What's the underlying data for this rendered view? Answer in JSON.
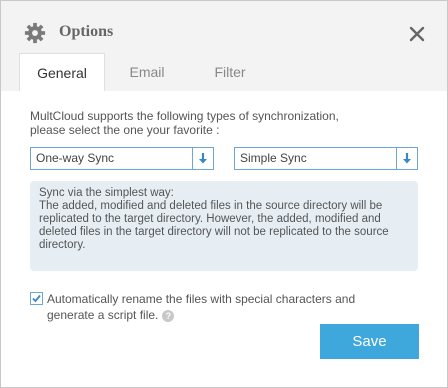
{
  "dialog": {
    "title": "Options",
    "icons": {
      "header": "gear-icon",
      "close": "close-icon",
      "select_arrow": "down-arrow-icon",
      "check": "checkmark-icon",
      "help": "question-icon"
    }
  },
  "tabs": [
    {
      "label": "General",
      "active": true
    },
    {
      "label": "Email",
      "active": false
    },
    {
      "label": "Filter",
      "active": false
    }
  ],
  "general": {
    "intro_line1": "MultCloud supports the following types of synchronization,",
    "intro_line2": "please select the one your favorite :",
    "sync_direction": {
      "value": "One-way Sync"
    },
    "sync_mode": {
      "value": "Simple Sync"
    },
    "info": {
      "heading": "Sync via the simplest way:",
      "body": "The added, modified and deleted files in the source directory will be replicated to the target directory. However, the added, modified and deleted files in the target directory will not be replicated to the source directory."
    },
    "auto_rename": {
      "checked": true,
      "label": "Automatically rename the files with special characters and generate a script file.",
      "help_glyph": "?"
    },
    "save_label": "Save"
  },
  "colors": {
    "accent": "#3ea8dd",
    "select_border": "#6ea6d8",
    "info_bg": "#e6eef4",
    "header_bg": "#f3f3f3"
  }
}
